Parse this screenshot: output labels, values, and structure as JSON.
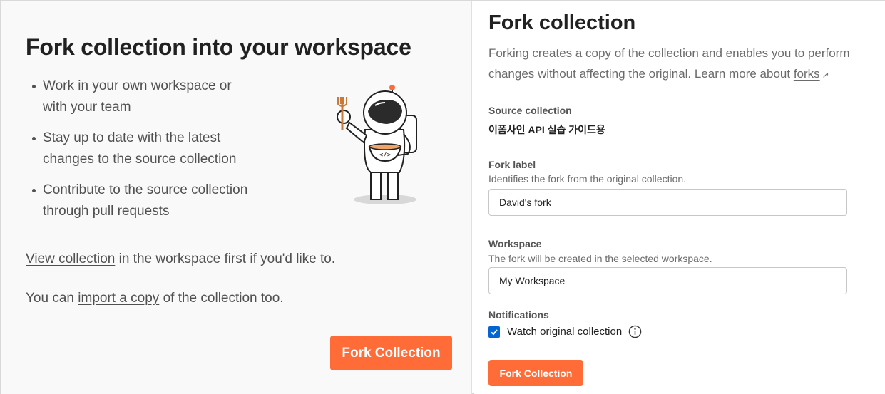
{
  "left": {
    "title": "Fork collection into your workspace",
    "bullets": [
      {
        "line1": "Work in your own workspace or",
        "line2": "with your team"
      },
      {
        "line1": "Stay up to date with the latest",
        "line2": "changes to the source collection"
      },
      {
        "line1": "Contribute to the source collection",
        "line2": "through pull requests"
      }
    ],
    "view_link": "View collection",
    "view_rest": " in the workspace first if you'd like to.",
    "import_prefix": "You can ",
    "import_link": "import a copy",
    "import_rest": " of the collection too.",
    "fork_button": "Fork Collection",
    "illustration": "astronaut-with-fork-and-bowl",
    "bowl_code": "</>"
  },
  "right": {
    "title": "Fork collection",
    "desc_line1": "Forking creates a copy of the collection and enables you to perform",
    "desc_line2_prefix": "changes without affecting the original. Learn more about ",
    "desc_link": "forks",
    "source_label": "Source collection",
    "source_value": "이폼사인 API 실습 가이드용",
    "fork_label": "Fork label",
    "fork_help": "Identifies the fork from the original collection.",
    "fork_value": "David's fork",
    "workspace_label": "Workspace",
    "workspace_help": "The fork will be created in the selected workspace.",
    "workspace_value": "My Workspace",
    "notifications_label": "Notifications",
    "watch_label": "Watch original collection",
    "watch_checked": true,
    "fork_button": "Fork Collection"
  },
  "colors": {
    "accent": "#ff6c37",
    "checkbox": "#0265d2",
    "left_bg": "#f9f9f9"
  }
}
